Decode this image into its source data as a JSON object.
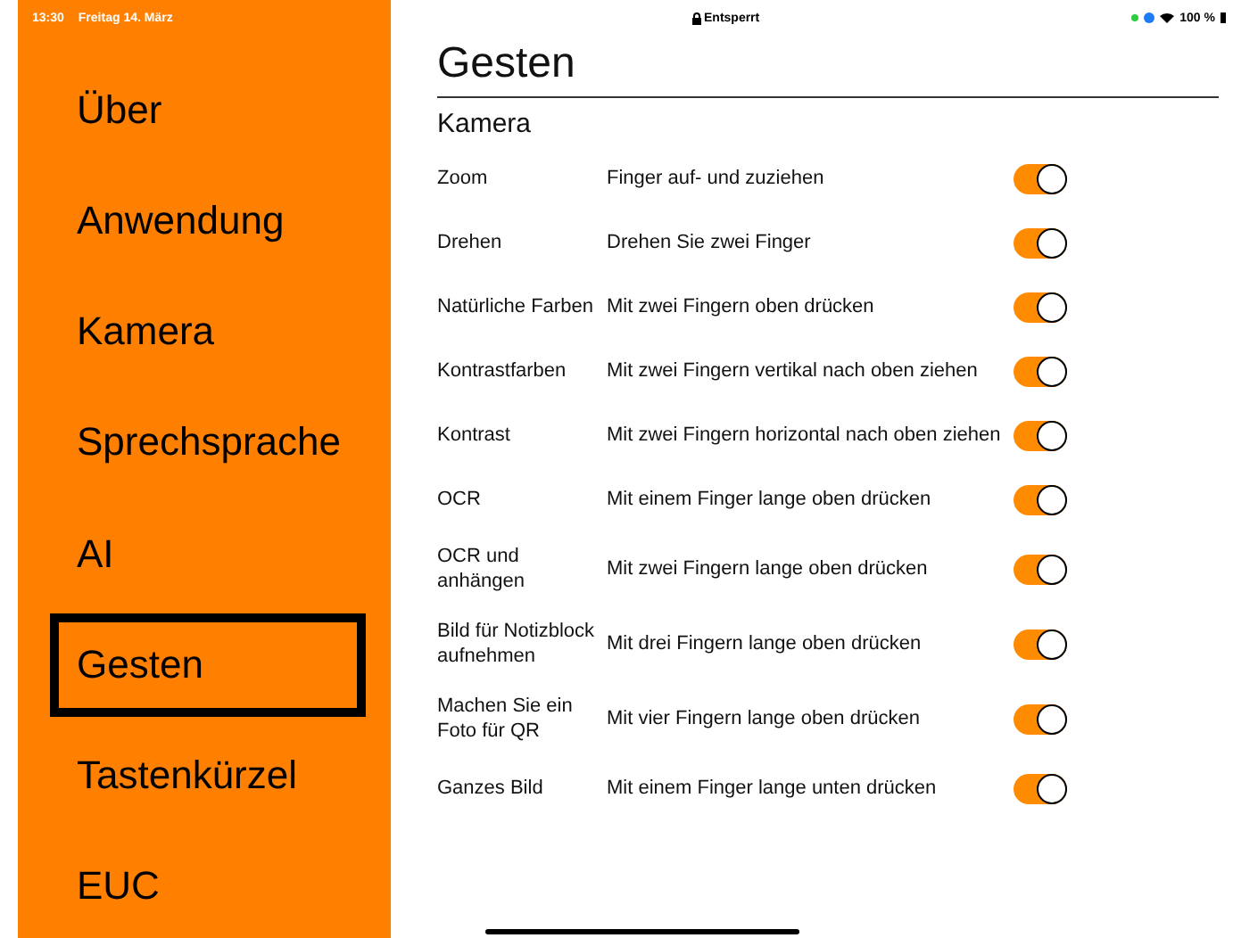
{
  "status_bar": {
    "time": "13:30",
    "date": "Freitag 14. März",
    "lock_text": "Entsperrt",
    "battery": "100 %"
  },
  "sidebar": {
    "items": [
      {
        "label": "Über",
        "selected": false
      },
      {
        "label": "Anwendung",
        "selected": false
      },
      {
        "label": "Kamera",
        "selected": false
      },
      {
        "label": "Sprechsprache",
        "selected": false
      },
      {
        "label": "AI",
        "selected": false
      },
      {
        "label": "Gesten",
        "selected": true
      },
      {
        "label": "Tastenkürzel",
        "selected": false
      },
      {
        "label": "EUC",
        "selected": false
      }
    ]
  },
  "page": {
    "title": "Gesten",
    "section": "Kamera",
    "gestures": [
      {
        "name": "Zoom",
        "description": "Finger auf- und zuziehen",
        "on": true
      },
      {
        "name": "Drehen",
        "description": "Drehen Sie zwei Finger",
        "on": true
      },
      {
        "name": "Natürliche Farben",
        "description": "Mit zwei Fingern oben drücken",
        "on": true
      },
      {
        "name": "Kontrastfarben",
        "description": "Mit zwei Fingern vertikal nach oben ziehen",
        "on": true
      },
      {
        "name": "Kontrast",
        "description": "Mit zwei Fingern horizontal nach oben ziehen",
        "on": true
      },
      {
        "name": "OCR",
        "description": "Mit einem Finger lange oben drücken",
        "on": true
      },
      {
        "name": "OCR und anhängen",
        "description": "Mit zwei Fingern lange oben drücken",
        "on": true
      },
      {
        "name": "Bild für Notizblock aufnehmen",
        "description": "Mit drei Fingern lange oben drücken",
        "on": true
      },
      {
        "name": "Machen Sie ein Foto für QR",
        "description": "Mit vier Fingern lange oben drücken",
        "on": true
      },
      {
        "name": "Ganzes Bild",
        "description": "Mit einem Finger lange unten drücken",
        "on": true
      }
    ]
  }
}
